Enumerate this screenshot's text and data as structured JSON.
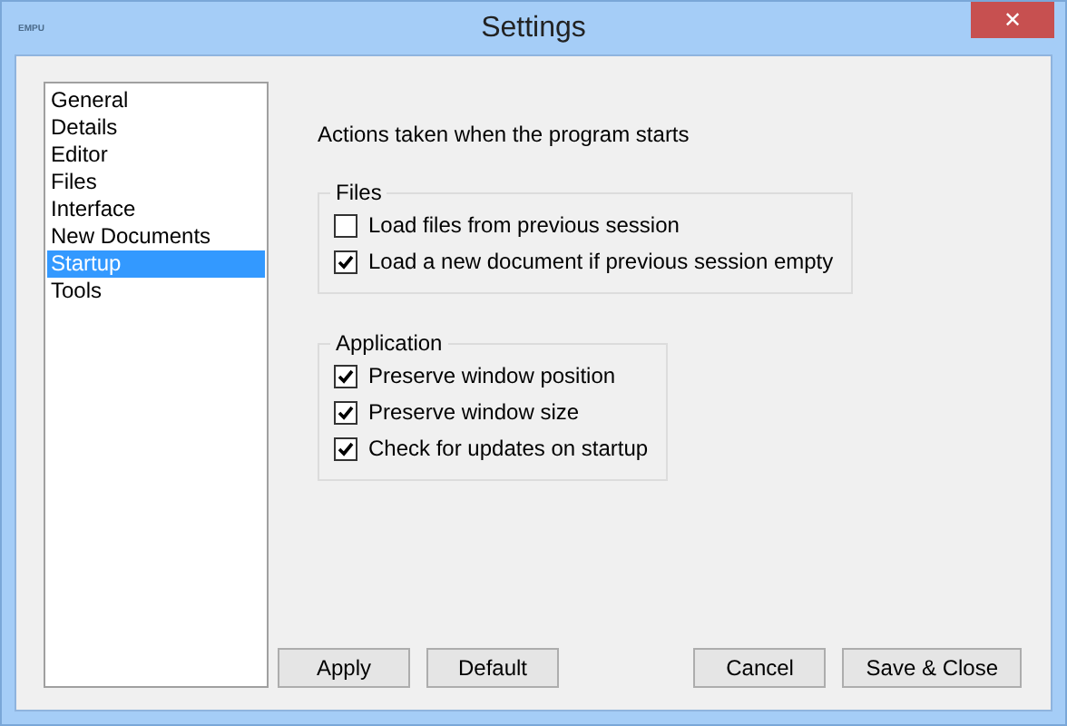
{
  "window": {
    "app_icon": "EMPU",
    "title": "Settings",
    "close": "✕"
  },
  "sidebar": {
    "items": [
      {
        "label": "General",
        "selected": false
      },
      {
        "label": "Details",
        "selected": false
      },
      {
        "label": "Editor",
        "selected": false
      },
      {
        "label": "Files",
        "selected": false
      },
      {
        "label": "Interface",
        "selected": false
      },
      {
        "label": "New Documents",
        "selected": false
      },
      {
        "label": "Startup",
        "selected": true
      },
      {
        "label": "Tools",
        "selected": false
      }
    ]
  },
  "heading": "Actions taken when the program starts",
  "groups": [
    {
      "title": "Files",
      "options": [
        {
          "label": "Load files from previous session",
          "checked": false
        },
        {
          "label": "Load a new document if previous session empty",
          "checked": true
        }
      ]
    },
    {
      "title": "Application",
      "options": [
        {
          "label": "Preserve window position",
          "checked": true
        },
        {
          "label": "Preserve window size",
          "checked": true
        },
        {
          "label": "Check for updates on startup",
          "checked": true
        }
      ]
    }
  ],
  "buttons_left": [
    "Apply",
    "Default"
  ],
  "buttons_right": [
    "Cancel",
    "Save & Close"
  ]
}
